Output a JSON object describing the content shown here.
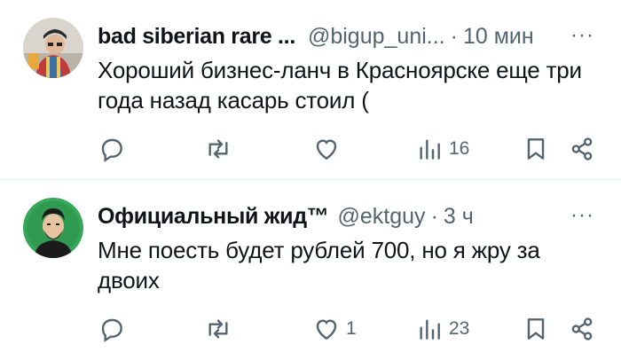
{
  "tweets": [
    {
      "display_name": "bad siberian rare ...",
      "handle": "@bigup_uni...",
      "separator": "·",
      "time": "10 мин",
      "more": "···",
      "text": "Хороший бизнес-ланч в Красноярске еще три года назад касарь стоил (",
      "replies": "",
      "retweets": "",
      "likes": "",
      "views": "16"
    },
    {
      "display_name": "Официальный жид™",
      "handle": "@ektguy",
      "separator": "·",
      "time": "3 ч",
      "more": "···",
      "text": "Мне поесть будет рублей 700, но я жру за двоих",
      "replies": "",
      "retweets": "",
      "likes": "1",
      "views": "23"
    }
  ],
  "icons": [
    "reply-icon",
    "retweet-icon",
    "like-icon",
    "views-icon",
    "bookmark-icon",
    "share-icon"
  ],
  "colors": {
    "text": "#0f1419",
    "secondary": "#536471",
    "divider": "#e6ecf0"
  }
}
